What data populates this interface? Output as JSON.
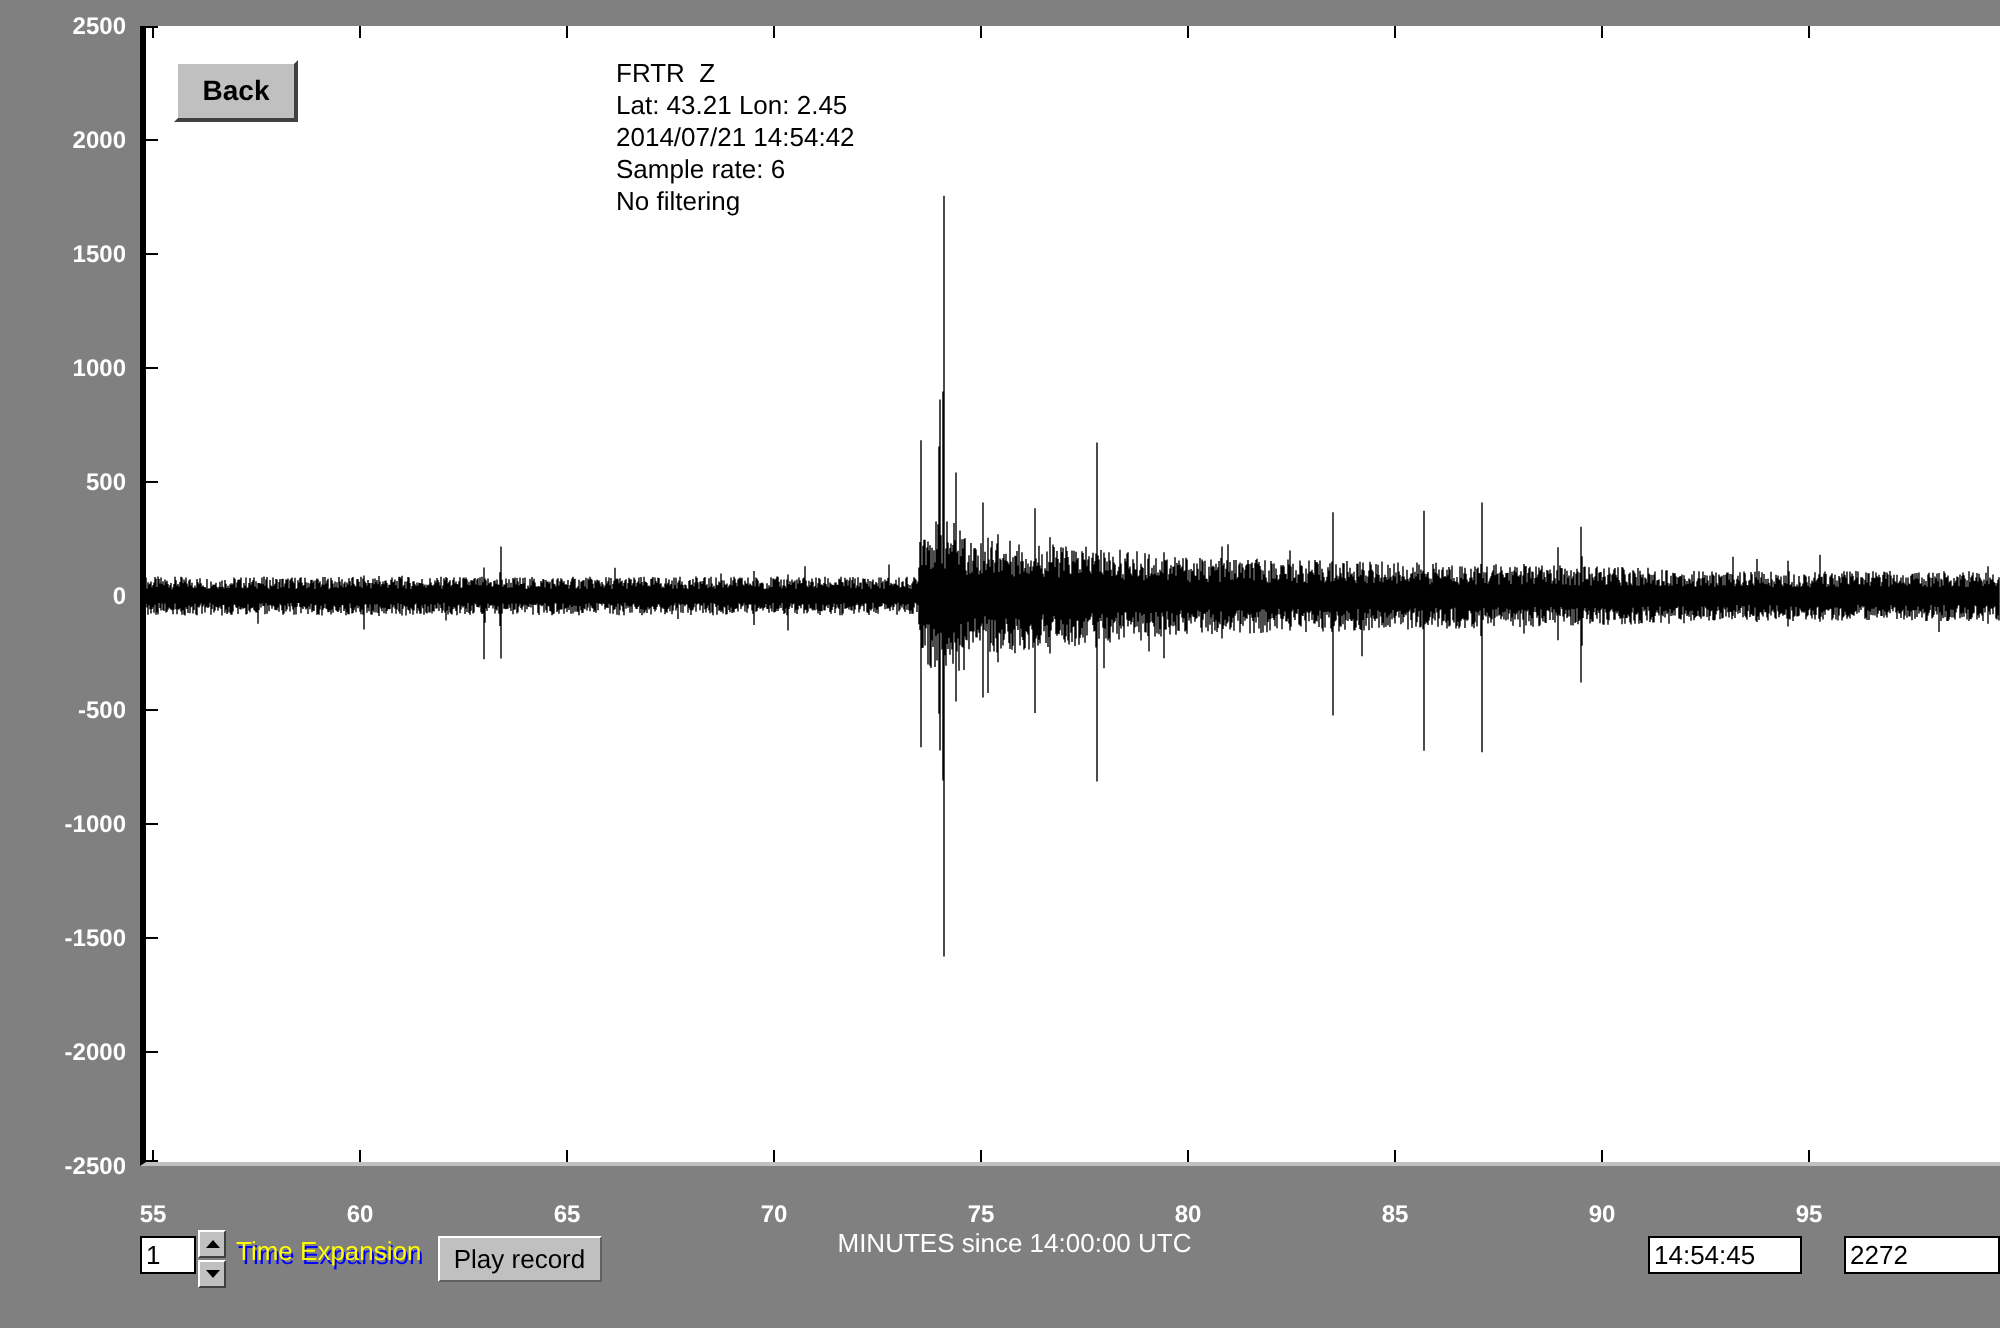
{
  "back_button": "Back",
  "station_info": [
    "FRTR  Z",
    "Lat: 43.21 Lon: 2.45",
    "2014/07/21 14:54:42",
    "Sample rate: 6",
    "No filtering"
  ],
  "y_axis": {
    "tick_labels": [
      "2500",
      "2000",
      "1500",
      "1000",
      "500",
      "0",
      "-500",
      "-1000",
      "-1500",
      "-2000",
      "-2500"
    ]
  },
  "x_axis": {
    "tick_labels": [
      "55",
      "60",
      "65",
      "70",
      "75",
      "80",
      "85",
      "90",
      "95"
    ],
    "title": "MINUTES since 14:00:00 UTC"
  },
  "time_expansion": {
    "value": "1",
    "label": "Time Expansion"
  },
  "play_button": "Play record",
  "time_field": {
    "value": "14:54:45"
  },
  "count_field": {
    "value": "2272"
  }
}
